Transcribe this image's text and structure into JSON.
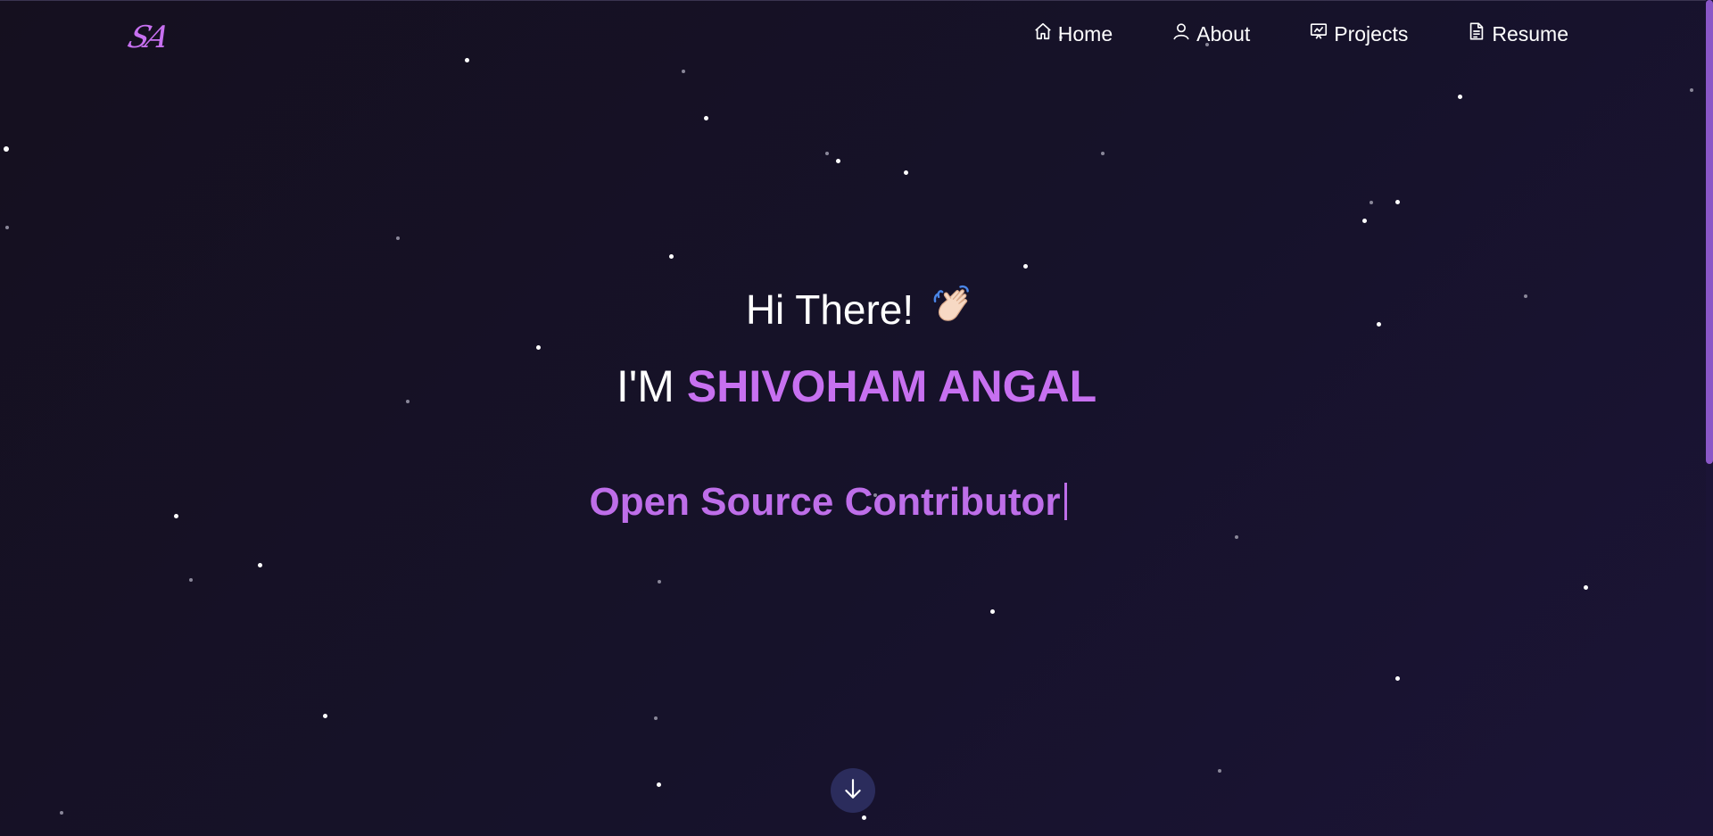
{
  "brand": {
    "logo_text": "SA",
    "accent_color": "#c770f0"
  },
  "nav": {
    "items": [
      {
        "label": "Home",
        "icon": "home-icon"
      },
      {
        "label": "About",
        "icon": "user-icon"
      },
      {
        "label": "Projects",
        "icon": "presentation-icon"
      },
      {
        "label": "Resume",
        "icon": "document-icon"
      }
    ]
  },
  "hero": {
    "greeting": "Hi There!",
    "greeting_icon": "waving-hand-icon",
    "intro_prefix": "I'M",
    "name": "SHIVOHAM ANGAL",
    "typed_role": "Open Source Contributor"
  },
  "scroll_button": {
    "icon": "arrow-down-icon"
  },
  "colors": {
    "background": "#15111f",
    "accent": "#c770f0",
    "scroll_button_bg": "#2b2c5c"
  }
}
